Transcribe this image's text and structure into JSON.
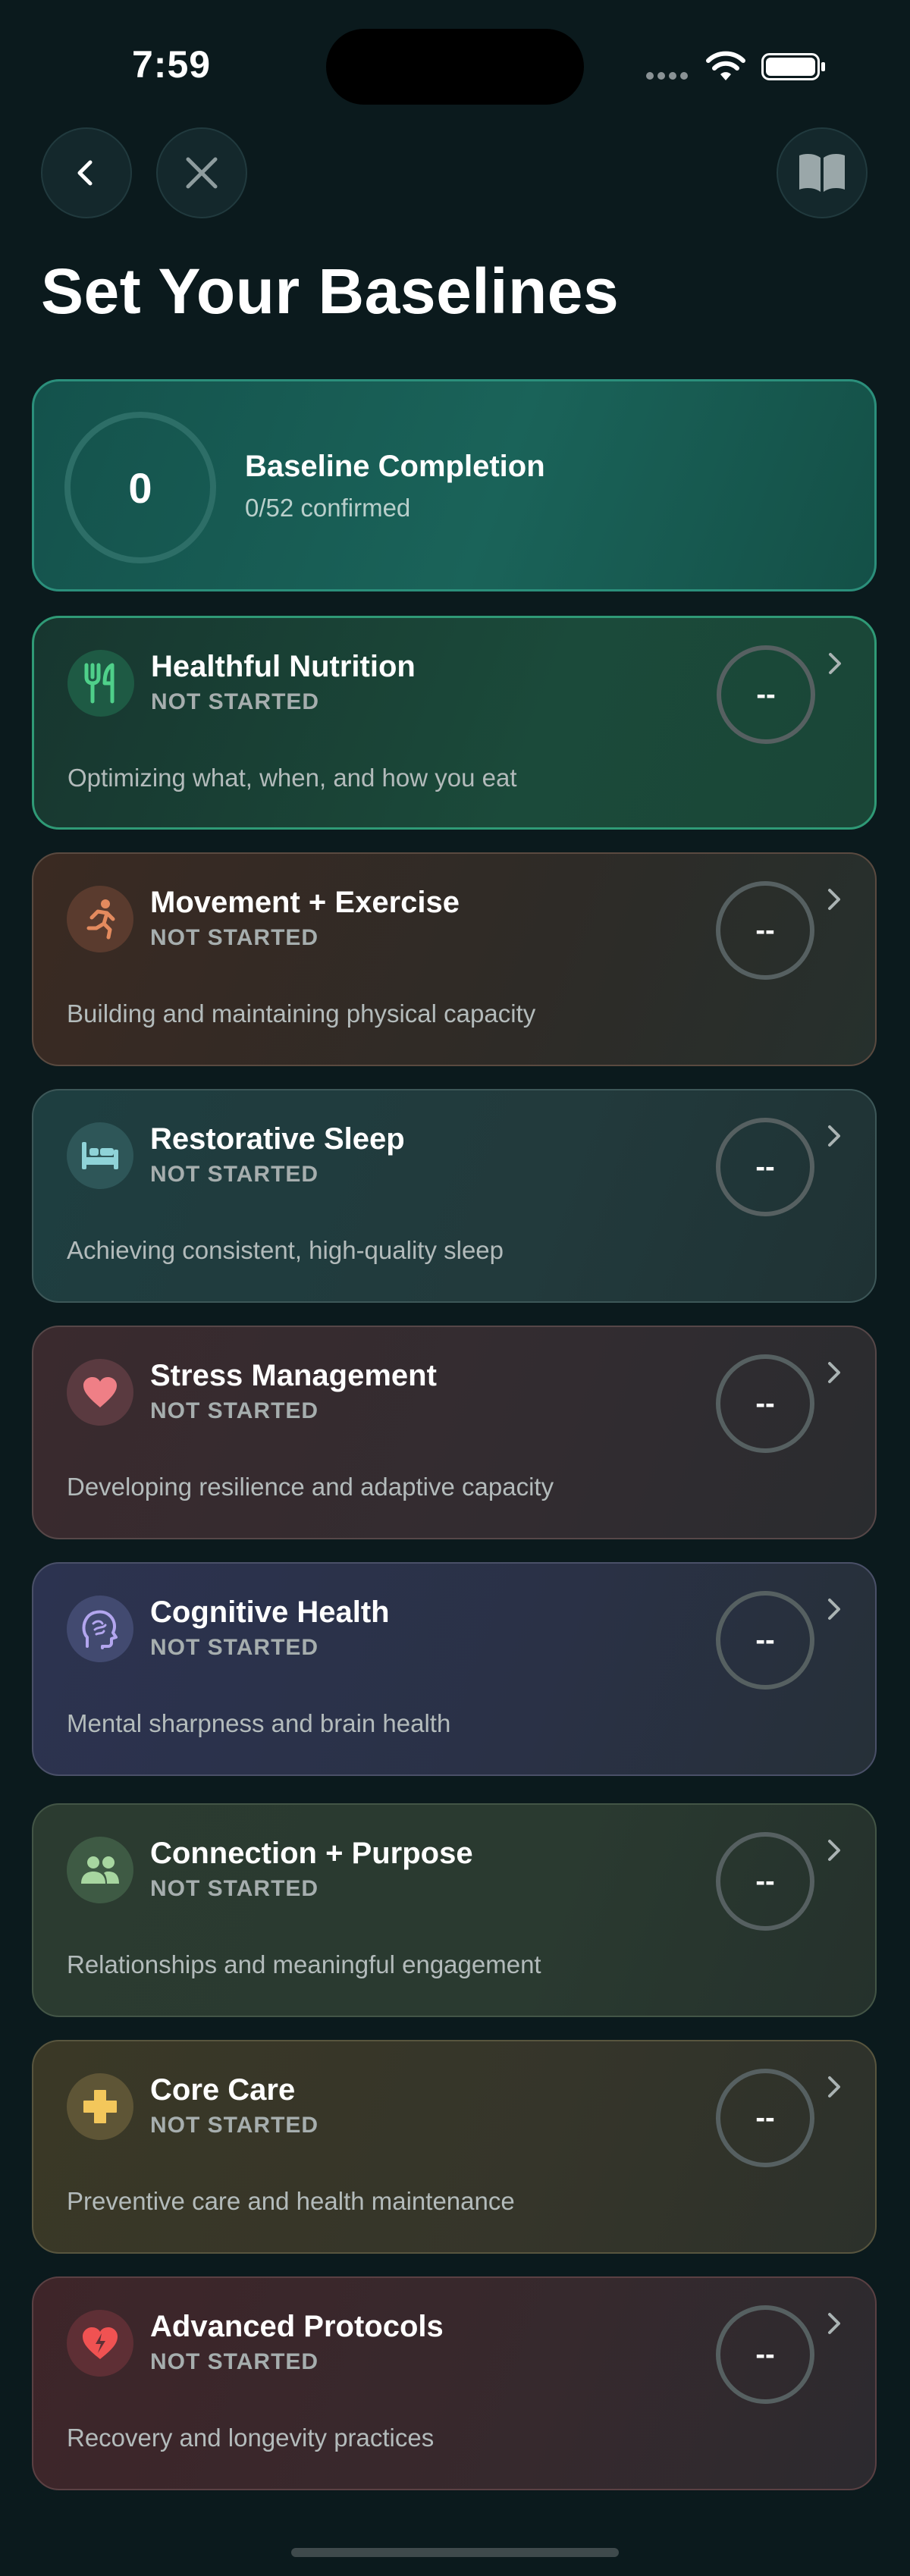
{
  "status_bar": {
    "time": "7:59"
  },
  "header": {
    "title": "Set Your Baselines",
    "back_icon": "chevron-left-icon",
    "close_icon": "close-icon",
    "book_icon": "book-icon"
  },
  "summary": {
    "value": "0",
    "title": "Baseline Completion",
    "subtitle": "0/52 confirmed"
  },
  "categories": [
    {
      "title": "Healthful Nutrition",
      "status": "NOT STARTED",
      "description": "Optimizing what, when, and how you eat",
      "score": "--",
      "icon": "fork-knife-icon",
      "accent": "#4fd08a"
    },
    {
      "title": "Movement + Exercise",
      "status": "NOT STARTED",
      "description": "Building and maintaining physical capacity",
      "score": "--",
      "icon": "running-icon",
      "accent": "#e38a5e"
    },
    {
      "title": "Restorative Sleep",
      "status": "NOT STARTED",
      "description": "Achieving consistent, high-quality sleep",
      "score": "--",
      "icon": "bed-icon",
      "accent": "#8fd3d8"
    },
    {
      "title": "Stress Management",
      "status": "NOT STARTED",
      "description": "Developing resilience and adaptive capacity",
      "score": "--",
      "icon": "heart-icon",
      "accent": "#ef7f86"
    },
    {
      "title": "Cognitive Health",
      "status": "NOT STARTED",
      "description": "Mental sharpness and brain health",
      "score": "--",
      "icon": "brain-icon",
      "accent": "#b3a6ef"
    },
    {
      "title": "Connection + Purpose",
      "status": "NOT STARTED",
      "description": "Relationships and meaningful engagement",
      "score": "--",
      "icon": "people-icon",
      "accent": "#a7d6a0"
    },
    {
      "title": "Core Care",
      "status": "NOT STARTED",
      "description": "Preventive care and health maintenance",
      "score": "--",
      "icon": "plus-cross-icon",
      "accent": "#f3c75b"
    },
    {
      "title": "Advanced Protocols",
      "status": "NOT STARTED",
      "description": "Recovery and longevity practices",
      "score": "--",
      "icon": "heart-bolt-icon",
      "accent": "#f05252"
    }
  ]
}
